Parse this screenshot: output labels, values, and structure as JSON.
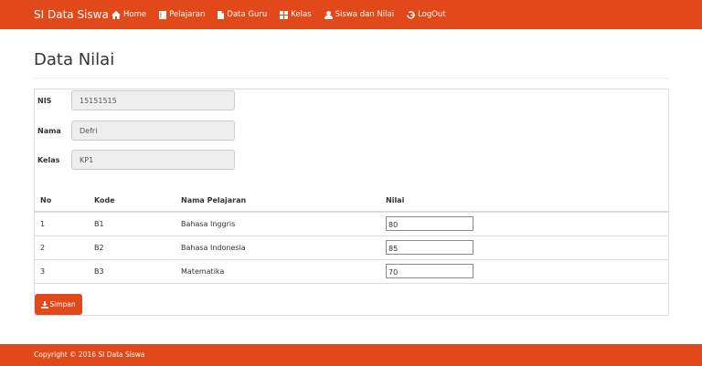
{
  "navbar": {
    "brand": "SI Data Siswa",
    "items": [
      {
        "label": "Home",
        "icon": "home-icon"
      },
      {
        "label": "Pelajaran",
        "icon": "book-icon"
      },
      {
        "label": "Data Guru",
        "icon": "file-icon"
      },
      {
        "label": "Kelas",
        "icon": "grid-icon"
      },
      {
        "label": "Siswa dan Nilai",
        "icon": "user-icon"
      },
      {
        "label": "LogOut",
        "icon": "logout-icon"
      }
    ]
  },
  "page": {
    "title": "Data Nilai"
  },
  "form": {
    "nis_label": "NIS",
    "nis_value": "15151515",
    "nama_label": "Nama",
    "nama_value": "Defri",
    "kelas_label": "Kelas",
    "kelas_value": "KP1"
  },
  "table": {
    "headers": [
      "No",
      "Kode",
      "Nama Pelajaran",
      "Nilai"
    ],
    "rows": [
      {
        "no": "1",
        "kode": "B1",
        "nama": "Bahasa Inggris",
        "nilai": "80"
      },
      {
        "no": "2",
        "kode": "B2",
        "nama": "Bahasa Indonesia",
        "nilai": "85"
      },
      {
        "no": "3",
        "kode": "B3",
        "nama": "Matematika",
        "nilai": "70"
      }
    ]
  },
  "actions": {
    "save_label": "Simpan",
    "save_icon": "download-icon"
  },
  "footer": {
    "text": "Copyright © 2016 SI Data Siswa"
  },
  "colors": {
    "brand": "#e2491a",
    "readonly_bg": "#eeeeee",
    "border": "#dddddd"
  }
}
